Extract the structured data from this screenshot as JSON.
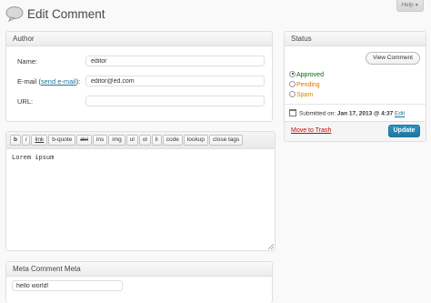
{
  "header": {
    "title": "Edit Comment",
    "help_label": "Help"
  },
  "author": {
    "title": "Author",
    "name_label": "Name:",
    "name_value": "editor",
    "email_label": "E-mail",
    "email_link": "send e-mail",
    "email_value": "editor@ed.com",
    "url_label": "URL:",
    "url_value": ""
  },
  "editor": {
    "toolbar": [
      "b",
      "i",
      "link",
      "b-quote",
      "del",
      "ins",
      "img",
      "ul",
      "ol",
      "li",
      "code",
      "lookup",
      "close tags"
    ],
    "content": "Lorem ipsum"
  },
  "meta": {
    "title": "Meta Comment Meta",
    "value": "hello world!"
  },
  "status": {
    "title": "Status",
    "view_button": "View Comment",
    "options": [
      {
        "label": "Approved",
        "checked": true,
        "color": "#006505"
      },
      {
        "label": "Pending",
        "checked": false,
        "color": "#e66f00"
      },
      {
        "label": "Spam",
        "checked": false,
        "color": "#d98500"
      }
    ],
    "submitted_prefix": "Submitted on:",
    "submitted_date": "Jan 17, 2013 @ 4:37",
    "edit_link": "Edit",
    "trash_link": "Move to Trash",
    "update_button": "Update"
  },
  "colors": {
    "link": "#21759b",
    "trash": "#bc0b0b",
    "primary_button": "#21759b"
  }
}
